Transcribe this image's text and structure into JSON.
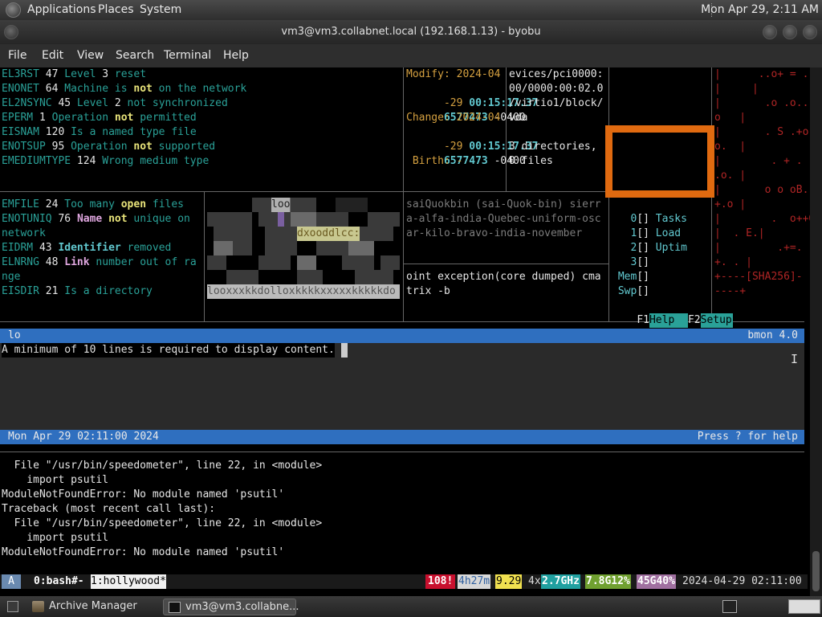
{
  "top_panel": {
    "menus": [
      "Applications",
      "Places",
      "System"
    ],
    "clock": "Mon Apr 29,  2:11 AM"
  },
  "window": {
    "title": "vm3@vm3.collabnet.local (192.168.1.13) - byobu"
  },
  "menubar": [
    "File",
    "Edit",
    "View",
    "Search",
    "Terminal",
    "Help"
  ],
  "errno_top": [
    {
      "name": "EL3RST",
      "num": "47",
      "pre": "Level ",
      "hl": "3",
      "post": " reset"
    },
    {
      "name": "ENONET",
      "num": "64",
      "pre": "Machine is ",
      "hl": "not",
      "post": " on the network"
    },
    {
      "name": "EL2NSYNC",
      "num": "45",
      "pre": "Level ",
      "hl": "2",
      "post": " not synchronized"
    },
    {
      "name": "EPERM",
      "num": "1",
      "pre": "Operation ",
      "hl": "not",
      "post": " permitted"
    },
    {
      "name": "EISNAM",
      "num": "120",
      "pre": "Is a named type file",
      "hl": "",
      "post": ""
    },
    {
      "name": "ENOTSUP",
      "num": "95",
      "pre": "Operation ",
      "hl": "not",
      "post": " supported"
    },
    {
      "name": "EMEDIUMTYPE",
      "num": "124",
      "pre": "Wrong medium type",
      "hl": "",
      "post": ""
    }
  ],
  "errno_bottom": [
    "EMFILE 24 Too many open files",
    "ENOTUNIQ 76 Name not unique on",
    "network",
    "EIDRM 43 Identifier removed",
    "ELNRNG 48 Link number out of ra",
    "nge",
    "EISDIR 21 Is a directory"
  ],
  "stat": {
    "modify_label": "Modify: 2024-04",
    "modify_date": "-29 ",
    "modify_time": "00:15:17.37",
    "modify_frac": "6577473",
    "modify_tz": " -0400",
    "change_label": "Change: 2024-04",
    "change_date": "-29 ",
    "change_time": "00:15:17.37",
    "change_frac": "6577473",
    "change_tz": " -0400",
    "birth": " Birth: -"
  },
  "path_lines": [
    "evices/pci0000:",
    "00/0000:00:02.0",
    "/virtio1/block/",
    "vda",
    "",
    "3 directories,",
    "0 files"
  ],
  "nato_lines": [
    "saiQuokbin (sai-Quok-bin) sierr",
    "a-alfa-india-Quebec-uniform-osc",
    "ar-kilo-bravo-india-november"
  ],
  "exception_lines": [
    "oint exception(core dumped) cma",
    "trix -b"
  ],
  "htop": {
    "rows": [
      {
        "num": "0",
        "bracket": "[]",
        "label": "Tasks"
      },
      {
        "num": "1",
        "bracket": "[]",
        "label": "Load"
      },
      {
        "num": "2",
        "bracket": "[]",
        "label": "Uptim"
      },
      {
        "num": "3",
        "bracket": "[]",
        "label": ""
      },
      {
        "num": "Mem",
        "bracket": "[]",
        "label": ""
      },
      {
        "num": "Swp",
        "bracket": "[]",
        "label": ""
      }
    ],
    "f1": "F1",
    "f1_label": "Help",
    "f2": "F2",
    "f2_label": "Setup"
  },
  "sha_art": [
    "|      ..o+ = .",
    "|     |",
    "|       .o .o..",
    "o   |",
    "|       . S .+o",
    "o.  |",
    "|        . + . .*",
    ".o. |",
    "|       o o oB.",
    "+.o |",
    "|        .  o++0",
    "|  . E.|",
    "|         .+=.",
    "+. . |",
    "+----[SHA256]-",
    "----+"
  ],
  "figlet": {
    "word1": "loo",
    "word2": "dxooddlcc:",
    "bottom": "looxxxkkdolloxkkkkxxxxxkkkkkdo"
  },
  "bmon": {
    "top_left": "lo",
    "top_right": "bmon 4.0",
    "message": "A minimum of 10 lines is required to display content.",
    "bottom_left": "Mon Apr 29 02:11:00 2024",
    "bottom_right": "Press ? for help"
  },
  "traceback": [
    "  File \"/usr/bin/speedometer\", line 22, in <module>",
    "    import psutil",
    "ModuleNotFoundError: No module named 'psutil'",
    "Traceback (most recent call last):",
    "  File \"/usr/bin/speedometer\", line 22, in <module>",
    "    import psutil",
    "ModuleNotFoundError: No module named 'psutil'"
  ],
  "status": {
    "logo": "A",
    "win0": "0:bash#-",
    "win1": "1:hollywood*",
    "updates": "108!",
    "uptime": "4h27m",
    "load": "9.29",
    "cpu_count": "4x",
    "cpu_freq": "2.7GHz",
    "mem": "7.8G12%",
    "disk": "45G40%",
    "datetime": "2024-04-29 02:11:00"
  },
  "taskbar": [
    {
      "label": "Archive Manager",
      "active": false
    },
    {
      "label": "vm3@vm3.collabne...",
      "active": true
    }
  ],
  "colors": {
    "bmon_bar": "#2f6fbf",
    "orange_box": "#e06a10",
    "teal_text": "#2aa198",
    "sha_red": "#b02525"
  }
}
